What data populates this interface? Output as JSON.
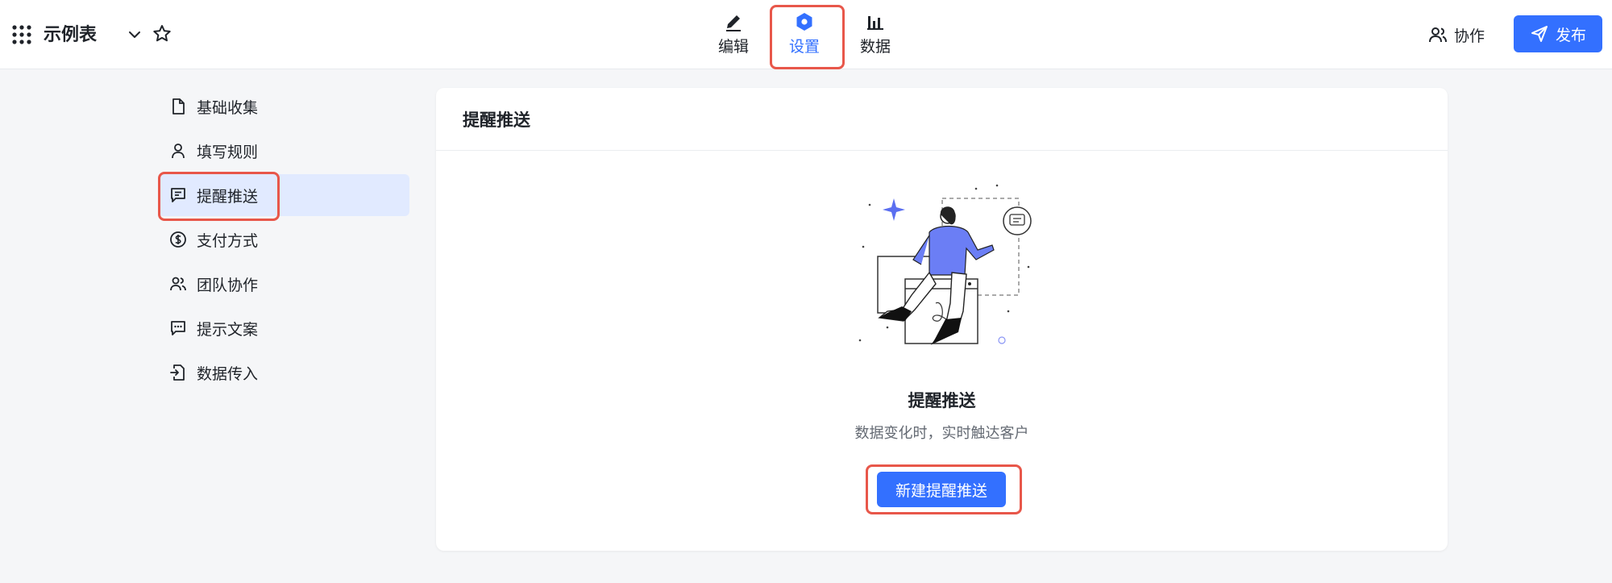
{
  "header": {
    "app_title": "示例表",
    "tabs": [
      {
        "label": "编辑",
        "icon": "pen-icon"
      },
      {
        "label": "设置",
        "icon": "hexagon-settings-icon",
        "active": true
      },
      {
        "label": "数据",
        "icon": "bar-chart-icon"
      }
    ],
    "collab_label": "协作",
    "publish_label": "发布"
  },
  "sidebar": {
    "items": [
      {
        "label": "基础收集",
        "icon": "file-icon"
      },
      {
        "label": "填写规则",
        "icon": "user-icon"
      },
      {
        "label": "提醒推送",
        "icon": "message-icon",
        "active": true
      },
      {
        "label": "支付方式",
        "icon": "dollar-icon"
      },
      {
        "label": "团队协作",
        "icon": "team-icon"
      },
      {
        "label": "提示文案",
        "icon": "chat-dots-icon"
      },
      {
        "label": "数据传入",
        "icon": "import-icon"
      }
    ]
  },
  "main": {
    "card_title": "提醒推送",
    "empty_title": "提醒推送",
    "empty_desc": "数据变化时，实时触达客户",
    "new_button_label": "新建提醒推送"
  },
  "colors": {
    "accent": "#3370ff",
    "highlight": "#e8574a",
    "active_bg": "#e1eaff"
  }
}
